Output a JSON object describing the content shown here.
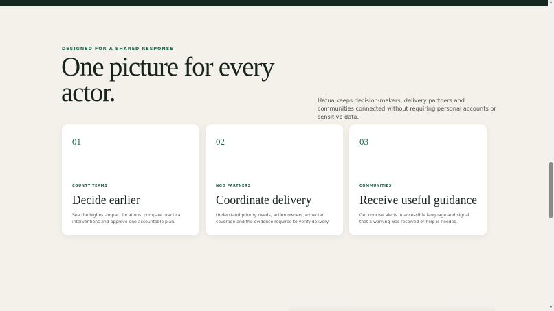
{
  "section": {
    "eyebrow": "DESIGNED FOR A SHARED RESPONSE",
    "headline": "One picture for every actor.",
    "intro": "Hatua keeps decision-makers, delivery partners and communities connected without requiring personal accounts or sensitive data."
  },
  "cards": [
    {
      "number": "01",
      "tag": "COUNTY TEAMS",
      "title": "Decide earlier",
      "description": "See the highest-impact locations, compare practical interventions and approve one accountable plan."
    },
    {
      "number": "02",
      "tag": "NGO PARTNERS",
      "title": "Coordinate delivery",
      "description": "Understand priority needs, action owners, expected coverage and the evidence required to verify delivery."
    },
    {
      "number": "03",
      "tag": "COMMUNITIES",
      "title": "Receive useful guidance",
      "description": "Get concise alerts in accessible language and signal that a warning was received or help is needed."
    }
  ],
  "scrollbar": {
    "up_arrow": "▲",
    "down_arrow": "▼",
    "position_fraction": 0.58
  },
  "colors": {
    "background": "#f3f1ea",
    "accent": "#1f6a4c",
    "topbar": "#16271f"
  }
}
